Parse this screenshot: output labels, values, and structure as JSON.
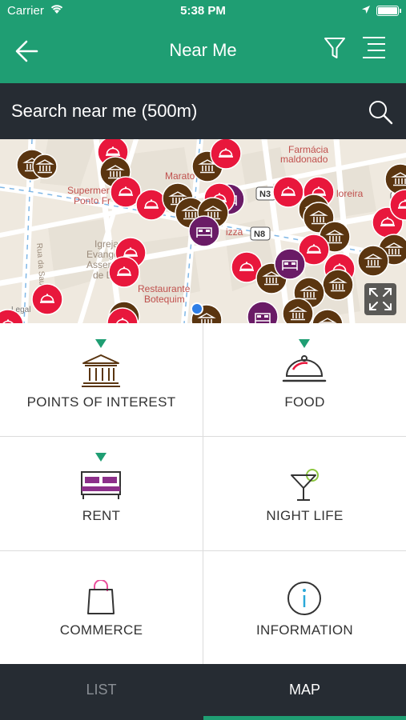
{
  "status_bar": {
    "carrier": "Carrier",
    "time": "5:38 PM"
  },
  "header": {
    "title": "Near Me",
    "back_icon": "arrow-left-icon",
    "filter_icon": "filter-icon",
    "menu_icon": "menu-icon"
  },
  "search": {
    "label": "Search near me (500m)",
    "icon": "search-icon"
  },
  "map": {
    "labels": {
      "pharmacy_1": "Farmácia",
      "pharmacy_2": "maldonado",
      "market_1": "Supermer",
      "market_2": "Ponto Fr",
      "maratona": "Marato",
      "church_1": "Igreja",
      "church_2": "Evangéli",
      "church_3": "Assemb",
      "church_4": "de De",
      "restaurant_1": "Restaurante",
      "restaurant_2": "Botequim",
      "pizza": "izza",
      "street": "Rua da Saudade",
      "florist": "loreira",
      "road_n3": "N3",
      "road_n8": "N8",
      "road_n2": "N",
      "legal": "Legal"
    },
    "marker_colors": {
      "food": "#e8173c",
      "poi": "#5a3510",
      "rent": "#6a1b66"
    }
  },
  "categories": [
    {
      "label": "POINTS OF INTEREST",
      "icon": "museum-icon",
      "selected": true
    },
    {
      "label": "FOOD",
      "icon": "cloche-icon",
      "selected": true
    },
    {
      "label": "RENT",
      "icon": "bed-icon",
      "selected": true
    },
    {
      "label": "NIGHT LIFE",
      "icon": "cocktail-icon",
      "selected": false
    },
    {
      "label": "COMMERCE",
      "icon": "shopping-bag-icon",
      "selected": false
    },
    {
      "label": "INFORMATION",
      "icon": "info-icon",
      "selected": false
    }
  ],
  "tabs": {
    "list": "LIST",
    "map": "MAP",
    "active": "MAP"
  },
  "colors": {
    "brand_green": "#1f9e73",
    "dark": "#262c33"
  }
}
